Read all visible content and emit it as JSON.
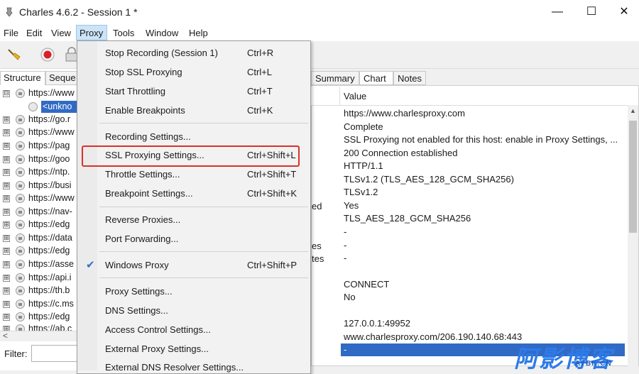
{
  "window": {
    "title": "Charles 4.6.2 - Session 1 *",
    "minimize": "—",
    "maximize": "☐",
    "close": "✕"
  },
  "menubar": [
    "File",
    "Edit",
    "View",
    "Proxy",
    "Tools",
    "Window",
    "Help"
  ],
  "left_panel": {
    "tabs": [
      "Structure",
      "Seque"
    ],
    "rows": [
      {
        "expander": "⊟",
        "host": "https://www"
      },
      {
        "expander": "⊞",
        "host": "https://go.r"
      },
      {
        "expander": "⊞",
        "host": "https://www"
      },
      {
        "expander": "⊞",
        "host": "https://pag"
      },
      {
        "expander": "⊞",
        "host": "https://goo"
      },
      {
        "expander": "⊞",
        "host": "https://ntp."
      },
      {
        "expander": "⊞",
        "host": "https://busi"
      },
      {
        "expander": "⊞",
        "host": "https://www"
      },
      {
        "expander": "⊞",
        "host": "https://nav-"
      },
      {
        "expander": "⊞",
        "host": "https://edg"
      },
      {
        "expander": "⊞",
        "host": "https://data"
      },
      {
        "expander": "⊞",
        "host": "https://edg"
      },
      {
        "expander": "⊞",
        "host": "https://asse"
      },
      {
        "expander": "⊞",
        "host": "https://api.i"
      },
      {
        "expander": "⊞",
        "host": "https://th.b"
      },
      {
        "expander": "⊞",
        "host": "https://c.ms"
      },
      {
        "expander": "⊞",
        "host": "https://edg"
      },
      {
        "expander": "⊞",
        "host": "https://ab.c"
      }
    ],
    "selected_child": "<unkno",
    "scroll_left": "<",
    "filter_label": "Filter:"
  },
  "right_panel": {
    "tabs": [
      "Summary",
      "Chart",
      "Notes"
    ],
    "column_value": "Value",
    "partial_labels": [
      "ed",
      "es",
      "tes"
    ],
    "values": [
      "https://www.charlesproxy.com",
      "Complete",
      "SSL Proxying not enabled for this host: enable in Proxy Settings, ...",
      "200 Connection established",
      "HTTP/1.1",
      "TLSv1.2 (TLS_AES_128_GCM_SHA256)",
      "TLSv1.2",
      "Yes",
      "TLS_AES_128_GCM_SHA256",
      "-",
      "-",
      "-",
      "",
      "CONNECT",
      "No",
      "",
      "127.0.0.1:49952",
      "www.charlesproxy.com/206.190.140.68:443",
      "-"
    ]
  },
  "proxy_menu": {
    "items": [
      {
        "label": "Stop Recording (Session 1)",
        "shortcut": "Ctrl+R"
      },
      {
        "label": "Stop SSL Proxying",
        "shortcut": "Ctrl+L"
      },
      {
        "label": "Start Throttling",
        "shortcut": "Ctrl+T"
      },
      {
        "label": "Enable Breakpoints",
        "shortcut": "Ctrl+K"
      },
      {
        "label": "Recording Settings...",
        "shortcut": ""
      },
      {
        "label": "SSL Proxying Settings...",
        "shortcut": "Ctrl+Shift+L",
        "highlighted": true
      },
      {
        "label": "Throttle Settings...",
        "shortcut": "Ctrl+Shift+T"
      },
      {
        "label": "Breakpoint Settings...",
        "shortcut": "Ctrl+Shift+K"
      },
      {
        "label": "Reverse Proxies...",
        "shortcut": ""
      },
      {
        "label": "Port Forwarding...",
        "shortcut": ""
      },
      {
        "label": "Windows Proxy",
        "shortcut": "Ctrl+Shift+P",
        "checked": true
      },
      {
        "label": "Proxy Settings...",
        "shortcut": ""
      },
      {
        "label": "DNS Settings...",
        "shortcut": ""
      },
      {
        "label": "Access Control Settings...",
        "shortcut": ""
      },
      {
        "label": "External Proxy Settings...",
        "shortcut": ""
      },
      {
        "label": "External DNS Resolver Settings...",
        "shortcut": ""
      }
    ],
    "check_glyph": "✔"
  },
  "watermark": {
    "main": "阿影博客",
    "sub": "AYBK.CN"
  },
  "colors": {
    "selection": "#316ac5",
    "highlight_border": "#d9312b",
    "watermark": "#2d7ae8"
  }
}
